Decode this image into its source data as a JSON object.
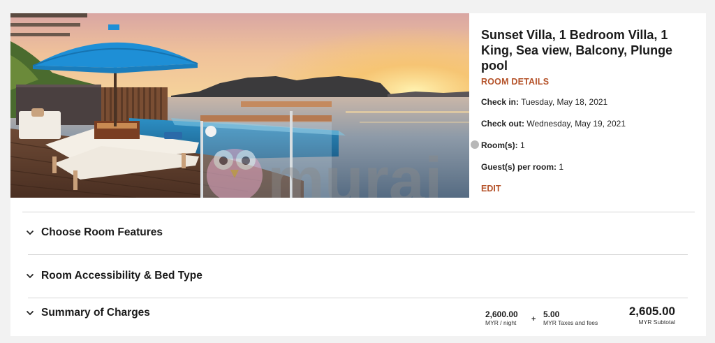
{
  "room": {
    "title": "Sunset Villa, 1 Bedroom Villa, 1 King, Sea view, Balcony, Plunge pool",
    "details_link": "ROOM DETAILS",
    "check_in_label": "Check in:",
    "check_in_value": "Tuesday, May 18, 2021",
    "check_out_label": "Check out:",
    "check_out_value": "Wednesday, May 19, 2021",
    "rooms_label": "Room(s):",
    "rooms_value": "1",
    "guests_label": "Guest(s) per room:",
    "guests_value": "1",
    "edit_link": "EDIT"
  },
  "hero_image": {
    "watermark": "murai"
  },
  "sections": [
    {
      "label": "Choose Room Features",
      "icon": "chevron-down-icon"
    },
    {
      "label": "Room Accessibility & Bed Type",
      "icon": "chevron-down-icon"
    },
    {
      "label": "Summary of Charges",
      "icon": "chevron-down-icon"
    }
  ],
  "charges": {
    "nightly_amount": "2,600.00",
    "nightly_label": "MYR / night",
    "plus": "+",
    "taxes_amount": "5.00",
    "taxes_label": "MYR Taxes and fees",
    "subtotal_amount": "2,605.00",
    "subtotal_label": "MYR Subtotal"
  },
  "colors": {
    "accent": "#b5532a",
    "umbrella": "#1e8fd6",
    "sea": "#4f7ea0",
    "sky_top": "#e9b79a",
    "sky_glow": "#f6c36a"
  }
}
